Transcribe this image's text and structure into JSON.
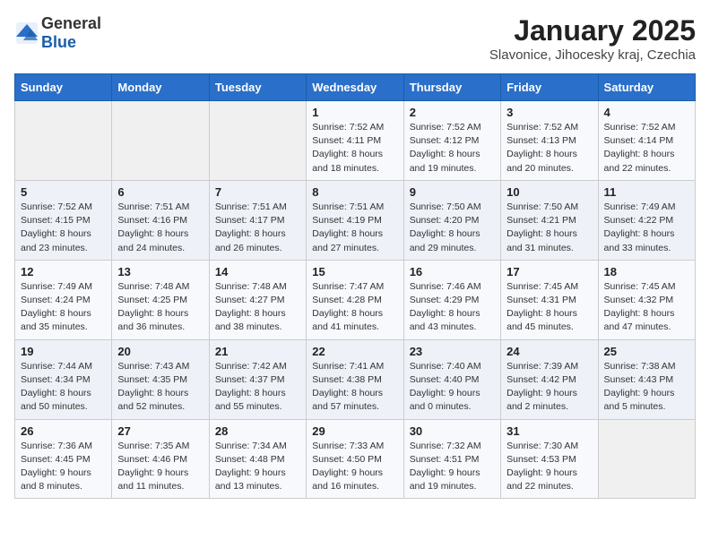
{
  "header": {
    "logo": {
      "text_general": "General",
      "text_blue": "Blue"
    },
    "title": "January 2025",
    "subtitle": "Slavonice, Jihocesky kraj, Czechia"
  },
  "weekdays": [
    "Sunday",
    "Monday",
    "Tuesday",
    "Wednesday",
    "Thursday",
    "Friday",
    "Saturday"
  ],
  "weeks": [
    [
      {
        "day": "",
        "info": ""
      },
      {
        "day": "",
        "info": ""
      },
      {
        "day": "",
        "info": ""
      },
      {
        "day": "1",
        "info": "Sunrise: 7:52 AM\nSunset: 4:11 PM\nDaylight: 8 hours and 18 minutes."
      },
      {
        "day": "2",
        "info": "Sunrise: 7:52 AM\nSunset: 4:12 PM\nDaylight: 8 hours and 19 minutes."
      },
      {
        "day": "3",
        "info": "Sunrise: 7:52 AM\nSunset: 4:13 PM\nDaylight: 8 hours and 20 minutes."
      },
      {
        "day": "4",
        "info": "Sunrise: 7:52 AM\nSunset: 4:14 PM\nDaylight: 8 hours and 22 minutes."
      }
    ],
    [
      {
        "day": "5",
        "info": "Sunrise: 7:52 AM\nSunset: 4:15 PM\nDaylight: 8 hours and 23 minutes."
      },
      {
        "day": "6",
        "info": "Sunrise: 7:51 AM\nSunset: 4:16 PM\nDaylight: 8 hours and 24 minutes."
      },
      {
        "day": "7",
        "info": "Sunrise: 7:51 AM\nSunset: 4:17 PM\nDaylight: 8 hours and 26 minutes."
      },
      {
        "day": "8",
        "info": "Sunrise: 7:51 AM\nSunset: 4:19 PM\nDaylight: 8 hours and 27 minutes."
      },
      {
        "day": "9",
        "info": "Sunrise: 7:50 AM\nSunset: 4:20 PM\nDaylight: 8 hours and 29 minutes."
      },
      {
        "day": "10",
        "info": "Sunrise: 7:50 AM\nSunset: 4:21 PM\nDaylight: 8 hours and 31 minutes."
      },
      {
        "day": "11",
        "info": "Sunrise: 7:49 AM\nSunset: 4:22 PM\nDaylight: 8 hours and 33 minutes."
      }
    ],
    [
      {
        "day": "12",
        "info": "Sunrise: 7:49 AM\nSunset: 4:24 PM\nDaylight: 8 hours and 35 minutes."
      },
      {
        "day": "13",
        "info": "Sunrise: 7:48 AM\nSunset: 4:25 PM\nDaylight: 8 hours and 36 minutes."
      },
      {
        "day": "14",
        "info": "Sunrise: 7:48 AM\nSunset: 4:27 PM\nDaylight: 8 hours and 38 minutes."
      },
      {
        "day": "15",
        "info": "Sunrise: 7:47 AM\nSunset: 4:28 PM\nDaylight: 8 hours and 41 minutes."
      },
      {
        "day": "16",
        "info": "Sunrise: 7:46 AM\nSunset: 4:29 PM\nDaylight: 8 hours and 43 minutes."
      },
      {
        "day": "17",
        "info": "Sunrise: 7:45 AM\nSunset: 4:31 PM\nDaylight: 8 hours and 45 minutes."
      },
      {
        "day": "18",
        "info": "Sunrise: 7:45 AM\nSunset: 4:32 PM\nDaylight: 8 hours and 47 minutes."
      }
    ],
    [
      {
        "day": "19",
        "info": "Sunrise: 7:44 AM\nSunset: 4:34 PM\nDaylight: 8 hours and 50 minutes."
      },
      {
        "day": "20",
        "info": "Sunrise: 7:43 AM\nSunset: 4:35 PM\nDaylight: 8 hours and 52 minutes."
      },
      {
        "day": "21",
        "info": "Sunrise: 7:42 AM\nSunset: 4:37 PM\nDaylight: 8 hours and 55 minutes."
      },
      {
        "day": "22",
        "info": "Sunrise: 7:41 AM\nSunset: 4:38 PM\nDaylight: 8 hours and 57 minutes."
      },
      {
        "day": "23",
        "info": "Sunrise: 7:40 AM\nSunset: 4:40 PM\nDaylight: 9 hours and 0 minutes."
      },
      {
        "day": "24",
        "info": "Sunrise: 7:39 AM\nSunset: 4:42 PM\nDaylight: 9 hours and 2 minutes."
      },
      {
        "day": "25",
        "info": "Sunrise: 7:38 AM\nSunset: 4:43 PM\nDaylight: 9 hours and 5 minutes."
      }
    ],
    [
      {
        "day": "26",
        "info": "Sunrise: 7:36 AM\nSunset: 4:45 PM\nDaylight: 9 hours and 8 minutes."
      },
      {
        "day": "27",
        "info": "Sunrise: 7:35 AM\nSunset: 4:46 PM\nDaylight: 9 hours and 11 minutes."
      },
      {
        "day": "28",
        "info": "Sunrise: 7:34 AM\nSunset: 4:48 PM\nDaylight: 9 hours and 13 minutes."
      },
      {
        "day": "29",
        "info": "Sunrise: 7:33 AM\nSunset: 4:50 PM\nDaylight: 9 hours and 16 minutes."
      },
      {
        "day": "30",
        "info": "Sunrise: 7:32 AM\nSunset: 4:51 PM\nDaylight: 9 hours and 19 minutes."
      },
      {
        "day": "31",
        "info": "Sunrise: 7:30 AM\nSunset: 4:53 PM\nDaylight: 9 hours and 22 minutes."
      },
      {
        "day": "",
        "info": ""
      }
    ]
  ]
}
